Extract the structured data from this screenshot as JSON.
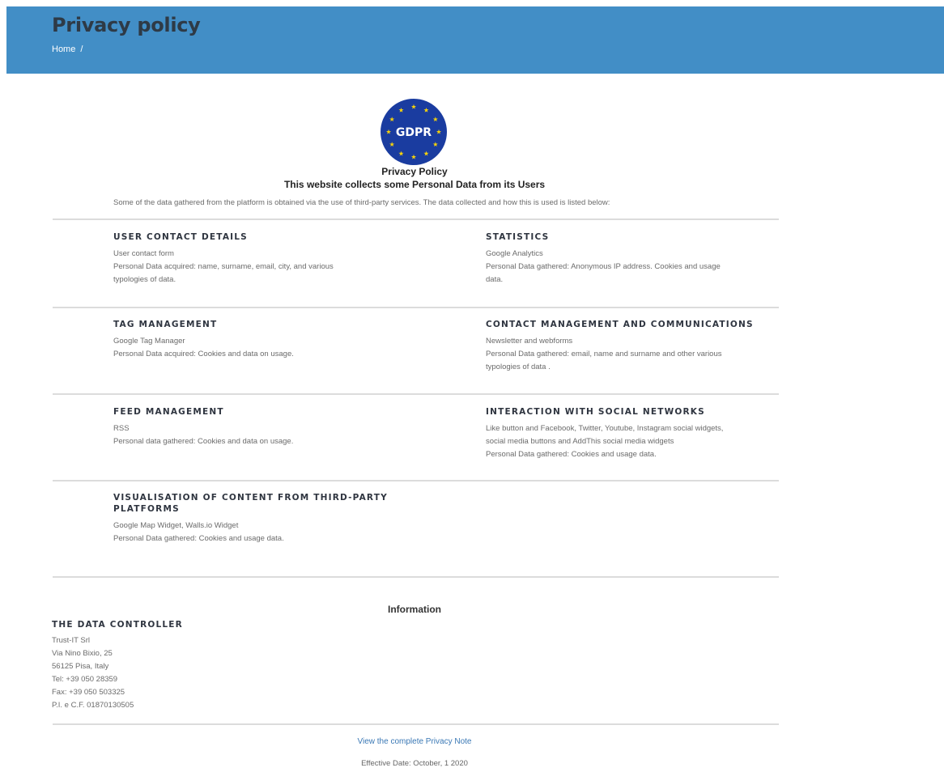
{
  "header": {
    "title": "Privacy policy",
    "breadcrumb_home": "Home",
    "breadcrumb_sep": "/",
    "bg_color": "#428ec6"
  },
  "gdpr_badge": {
    "text": "GDPR",
    "bg_color": "#1a3ca0",
    "star_color": "#f5d20c"
  },
  "intro": {
    "heading": "Privacy Policy",
    "subheading": "This website collects some Personal Data from its Users",
    "text": "Some of the data gathered from the platform is obtained via the use of third-party services. The data collected and how this is used is listed below:"
  },
  "sections": [
    {
      "title": "USER CONTACT DETAILS",
      "lines": [
        "User contact form",
        "Personal Data acquired: name, surname, email, city, and various",
        "typologies of data."
      ]
    },
    {
      "title": "STATISTICS",
      "lines": [
        "Google Analytics",
        "Personal Data gathered: Anonymous IP address. Cookies and usage",
        "data."
      ]
    },
    {
      "title": "TAG MANAGEMENT",
      "lines": [
        "Google Tag Manager",
        "Personal Data acquired: Cookies and data on usage."
      ]
    },
    {
      "title": "CONTACT MANAGEMENT AND COMMUNICATIONS",
      "lines": [
        "Newsletter and webforms",
        "Personal Data gathered: email, name and surname and other various",
        "typologies of data ."
      ]
    },
    {
      "title": "FEED MANAGEMENT",
      "lines": [
        "RSS",
        "Personal data gathered: Cookies and data on usage."
      ]
    },
    {
      "title": "INTERACTION WITH SOCIAL NETWORKS",
      "lines": [
        "Like button and Facebook, Twitter, Youtube, Instagram social widgets,",
        "social media buttons and AddThis social media widgets",
        "Personal Data gathered: Cookies and usage data."
      ]
    },
    {
      "title": "VISUALISATION OF CONTENT FROM THIRD-PARTY PLATFORMS",
      "lines": [
        "Google Map Widget, Walls.io Widget",
        "Personal Data gathered: Cookies and usage data."
      ]
    }
  ],
  "information": {
    "title": "Information",
    "controller_title": "THE DATA CONTROLLER",
    "lines": [
      "Trust-IT Srl",
      "Via Nino Bixio, 25",
      "56125 Pisa, Italy",
      "Tel: +39 050 28359",
      "Fax: +39 050 503325",
      "P.I. e C.F. 01870130505"
    ]
  },
  "footer": {
    "link_label": "View the complete Privacy Note",
    "effective_date": "Effective Date: October, 1 2020"
  }
}
